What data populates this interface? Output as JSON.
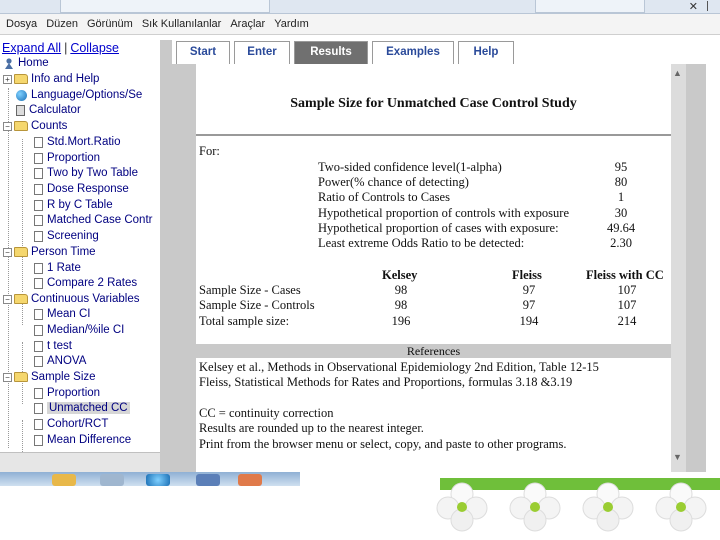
{
  "menu": [
    "Dosya",
    "Düzen",
    "Görünüm",
    "Sık Kullanılanlar",
    "Araçlar",
    "Yardım"
  ],
  "tree": {
    "expand_all": "Expand All",
    "separator": "|",
    "collapse": "Collapse",
    "items": [
      "Home",
      "Info and Help",
      "Language/Options/Se",
      "Calculator",
      "Counts",
      "Std.Mort.Ratio",
      "Proportion",
      "Two by Two Table",
      "Dose Response",
      "R by C Table",
      "Matched Case Contr",
      "Screening",
      "Person Time",
      "1 Rate",
      "Compare 2 Rates",
      "Continuous Variables",
      "Mean CI",
      "Median/%ile CI",
      "t test",
      "ANOVA",
      "Sample Size",
      "Proportion",
      "Unmatched CC",
      "Cohort/RCT",
      "Mean Difference"
    ]
  },
  "tabs": [
    "Start",
    "Enter",
    "Results",
    "Examples",
    "Help"
  ],
  "content": {
    "title": "Sample Size for Unmatched Case Control Study",
    "for_label": "For:",
    "params": [
      {
        "label": "Two-sided confidence level(1-alpha)",
        "value": "95"
      },
      {
        "label": "Power(% chance of detecting)",
        "value": "80"
      },
      {
        "label": "Ratio of Controls to Cases",
        "value": "1"
      },
      {
        "label": "Hypothetical proportion of controls with exposure",
        "value": "30"
      },
      {
        "label": "Hypothetical proportion of cases with exposure:",
        "value": "49.64"
      },
      {
        "label": "Least extreme Odds Ratio to be detected:",
        "value": "2.30"
      }
    ],
    "headers": [
      "Kelsey",
      "Fleiss",
      "Fleiss with CC"
    ],
    "results": [
      {
        "label": "Sample Size - Cases",
        "kelsey": "98",
        "fleiss": "97",
        "fleiss_cc": "107"
      },
      {
        "label": "Sample Size - Controls",
        "kelsey": "98",
        "fleiss": "97",
        "fleiss_cc": "107"
      },
      {
        "label": "Total sample size:",
        "kelsey": "196",
        "fleiss": "194",
        "fleiss_cc": "214"
      }
    ],
    "references_label": "References",
    "ref1": "Kelsey et al., Methods in Observational Epidemiology 2nd Edition, Table 12-15",
    "ref2": "Fleiss, Statistical Methods for Rates and Proportions, formulas 3.18 &3.19",
    "cc_note": "CC = continuity correction",
    "note2": "Results are rounded up to the nearest integer.",
    "note3": "Print from the browser menu or select, copy, and paste to other programs."
  },
  "colors": {
    "active_tab": "#707070",
    "tab_text": "#2a4a9a",
    "tree_text": "#000080",
    "link": "#0000cc",
    "panel_gray": "#c9c9c9",
    "green_band": "#6fbf3a"
  }
}
